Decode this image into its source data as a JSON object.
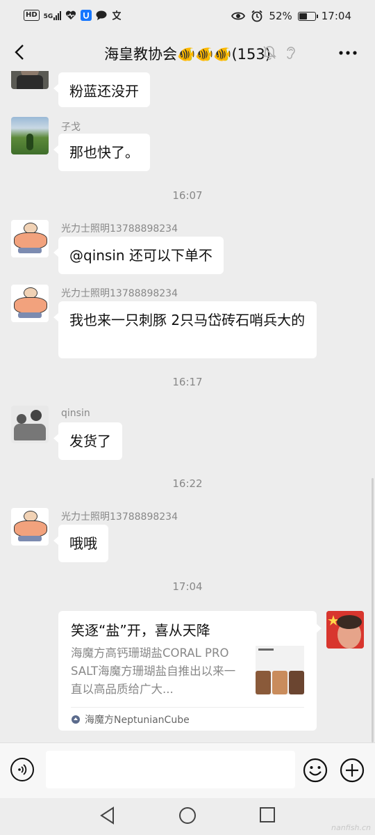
{
  "status_bar": {
    "left_icons": [
      "hd-icon",
      "5g-signal-icon",
      "health-icon",
      "app-u-icon",
      "chat-bubble-icon",
      "translate-icon"
    ],
    "hd_label": "HD",
    "g5_label": "5G",
    "battery": "52%",
    "battery_level": 0.52,
    "time": "17:04"
  },
  "nav": {
    "title": "海皇教协会🐠🐠🐠(153)"
  },
  "messages": [
    {
      "sender": "",
      "text": "粉蓝还没开"
    },
    {
      "sender": "子戈",
      "text": "那也快了。"
    },
    {
      "time": "16:07"
    },
    {
      "sender": "光力士照明13788898234",
      "text": "@qinsin  还可以下单不"
    },
    {
      "sender": "光力士照明13788898234",
      "text": "我也来一只刺豚   2只马岱砖石哨兵大的"
    },
    {
      "time": "16:17"
    },
    {
      "sender": "qinsin",
      "text": "发货了"
    },
    {
      "time": "16:22"
    },
    {
      "sender": "光力士照明13788898234",
      "text": "哦哦"
    },
    {
      "time": "17:04"
    }
  ],
  "card": {
    "title": "笑逐“盐”开，喜从天降",
    "description": "海魔方高钙珊瑚盐CORAL PRO SALT海魔方珊瑚盐自推出以来一直以高品质给广大...",
    "source": "海魔方NeptunianCube"
  },
  "input": {
    "placeholder": ""
  },
  "watermark": "nanfish.cn",
  "colors": {
    "background": "#ededed",
    "bubble": "#ffffff",
    "meta_text": "#888888"
  }
}
